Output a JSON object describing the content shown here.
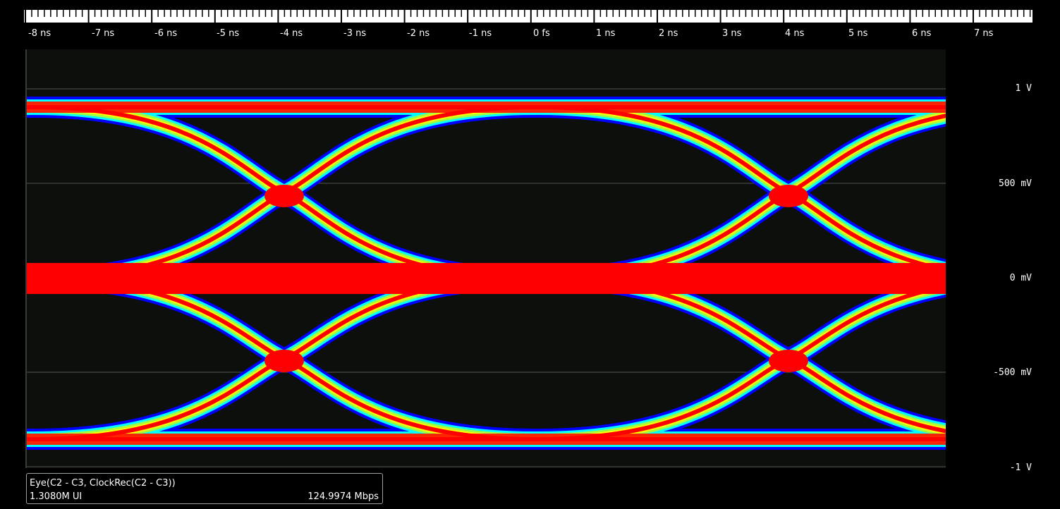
{
  "time_axis": {
    "ticks": [
      "-8 ns",
      "-7 ns",
      "-6 ns",
      "-5 ns",
      "-4 ns",
      "-3 ns",
      "-2 ns",
      "-1 ns",
      "0 fs",
      "1 ns",
      "2 ns",
      "3 ns",
      "4 ns",
      "5 ns",
      "6 ns",
      "7 ns"
    ]
  },
  "voltage_axis": {
    "labels": [
      "1 V",
      "500 mV",
      "0 mV",
      "-500 mV",
      "-1 V"
    ]
  },
  "eye": {
    "title": "Eye(C2 - C3, ClockRec(C2 - C3))",
    "ui_count": "1.3080M UI",
    "bit_rate": "124.9974 Mbps"
  },
  "colors": {
    "background": "#000000",
    "plot_bg": "#0d0f0d",
    "persistence_low": "#0000ff",
    "persistence_mid_low": "#00ffff",
    "persistence_mid": "#a0ff40",
    "persistence_mid_high": "#ffff00",
    "persistence_high": "#ff0000"
  }
}
